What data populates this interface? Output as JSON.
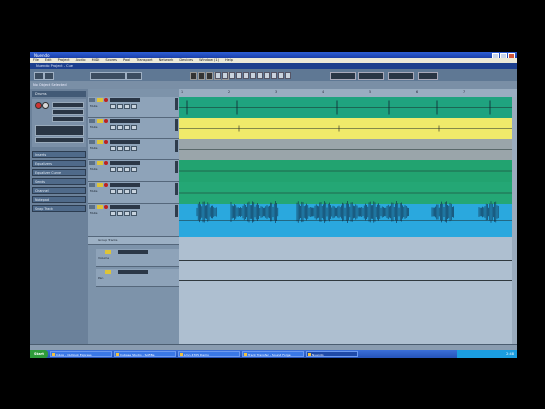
{
  "window": {
    "title": "Nuendo"
  },
  "menu": {
    "items": [
      "File",
      "Edit",
      "Project",
      "Audio",
      "MIDI",
      "Scores",
      "Pool",
      "Transport",
      "Network",
      "Devices",
      "Window (1)",
      "Help"
    ]
  },
  "project": {
    "title": "Nuendo Project - Cue"
  },
  "infoline": {
    "text": "No Object Selected"
  },
  "inspector": {
    "track_name": "Drums",
    "sections": [
      "Inserts",
      "Equalizers",
      "Equalizer Curve",
      "Sends",
      "Channel",
      "Notepad",
      "Snap Track"
    ]
  },
  "tracks": [
    {
      "name": "Drums",
      "color": "#1fa37f",
      "label": "Mute"
    },
    {
      "name": "Bass",
      "color": "#f0ea6a",
      "label": "Mute"
    },
    {
      "name": "Gtr",
      "color": "#9aa5aa",
      "label": "Mute"
    },
    {
      "name": "Keys",
      "color": "#22a370",
      "label": "Mute"
    },
    {
      "name": "Pad",
      "color": "#24a775",
      "label": "Mute"
    },
    {
      "name": "Vox",
      "color": "#2aa8de",
      "label": "Mute"
    }
  ],
  "folder": {
    "name": "Group Tracks"
  },
  "automation": [
    {
      "label": "Volume"
    },
    {
      "label": "Pan"
    }
  ],
  "ruler": {
    "marks": [
      "1",
      "2",
      "3",
      "4",
      "5",
      "6",
      "7"
    ]
  },
  "taskbar": {
    "start": "Start",
    "tasks": [
      "Inbox - Outlook Express",
      "Cubase Studio - SoftBe",
      "Lmn 4705 Demo",
      "Track Transfer - Sound Forge",
      "Nuendo"
    ],
    "clock": "2:48"
  }
}
